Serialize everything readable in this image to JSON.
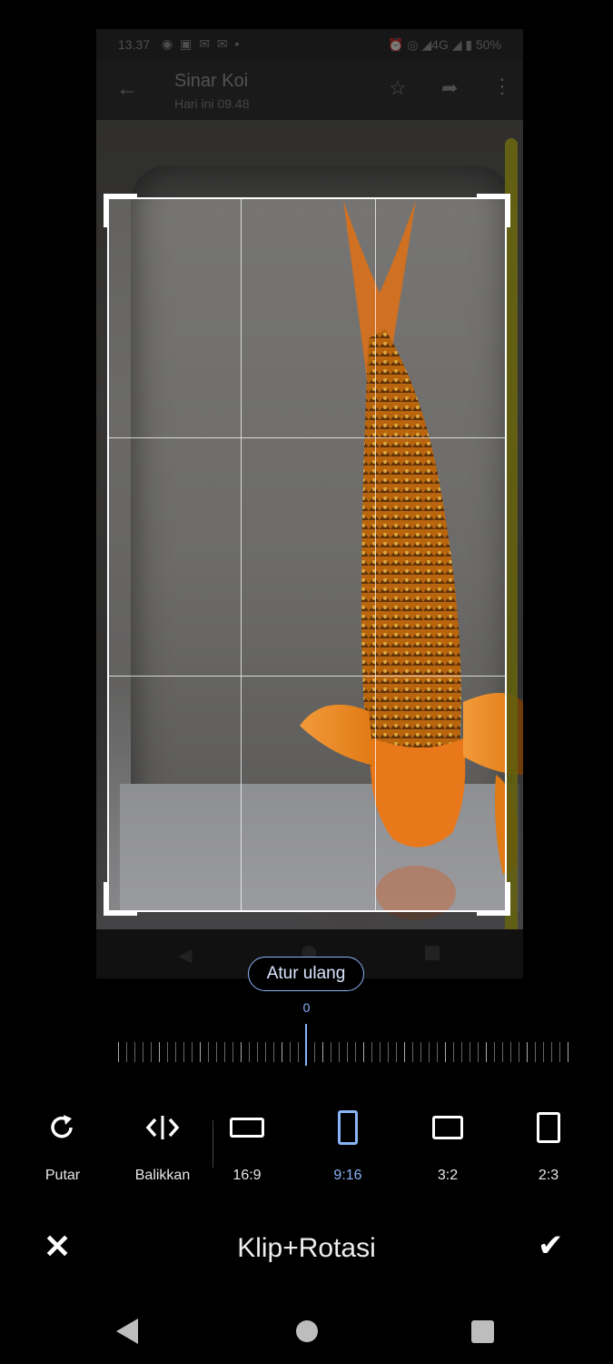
{
  "photo": {
    "status": {
      "time": "13.37",
      "glyphs": "◉ ▣ ✉ ✉ •",
      "right": "⏰ ◎ ◢4G ◢ ▮ 50%"
    },
    "appbar": {
      "title": "Sinar Koi",
      "subtitle": "Hari ini 09.48"
    }
  },
  "editor": {
    "reset_label": "Atur ulang",
    "rotation_angle": "0",
    "tools": [
      {
        "label": "Putar",
        "icon": "rotate-icon"
      },
      {
        "label": "Balikkan",
        "icon": "flip-icon"
      },
      {
        "label": "16:9",
        "icon": "ratio-16-9-icon"
      },
      {
        "label": "9:16",
        "icon": "ratio-9-16-icon",
        "selected": true
      },
      {
        "label": "3:2",
        "icon": "ratio-3-2-icon"
      },
      {
        "label": "2:3",
        "icon": "ratio-2-3-icon"
      }
    ],
    "title": "Klip+Rotasi"
  },
  "colors": {
    "accent": "#8ab4f8",
    "crop_frame": "#ffffff",
    "background": "#000000"
  }
}
